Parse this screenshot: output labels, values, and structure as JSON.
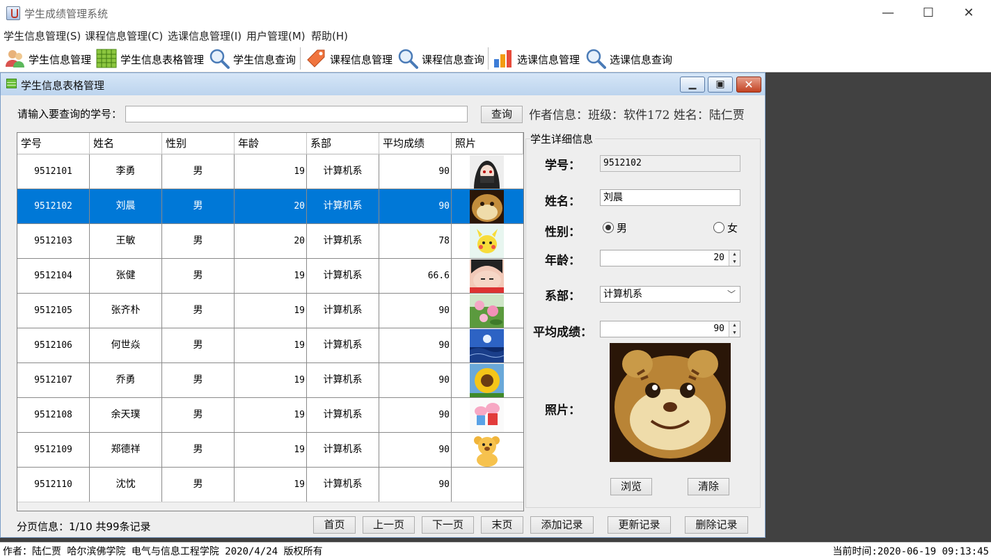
{
  "window": {
    "title": "学生成绩管理系统",
    "minimize_glyph": "—",
    "maximize_glyph": "☐",
    "close_glyph": "✕"
  },
  "menu": [
    "学生信息管理(S)",
    "课程信息管理(C)",
    "选课信息管理(I)",
    "用户管理(M)",
    "帮助(H)"
  ],
  "toolbar": [
    {
      "label": "学生信息管理",
      "icon": "users-icon"
    },
    {
      "label": "学生信息表格管理",
      "icon": "table-grid-icon"
    },
    {
      "label": "学生信息查询",
      "icon": "magnifier-icon"
    },
    {
      "label": "课程信息管理",
      "icon": "tag-icon"
    },
    {
      "label": "课程信息查询",
      "icon": "magnifier-icon"
    },
    {
      "label": "选课信息管理",
      "icon": "bar-chart-icon"
    },
    {
      "label": "选课信息查询",
      "icon": "magnifier-icon"
    }
  ],
  "internal_frame": {
    "title": "学生信息表格管理",
    "minimize_glyph": "▁",
    "maximize_glyph": "▣",
    "close_glyph": "✕"
  },
  "query": {
    "label": "请输入要查询的学号：",
    "value": "",
    "button": "查询",
    "author_info": "作者信息：班级：软件172 姓名：陆仁贾"
  },
  "table": {
    "columns": [
      "学号",
      "姓名",
      "性别",
      "年龄",
      "系部",
      "平均成绩",
      "照片"
    ],
    "rows": [
      {
        "id": "9512101",
        "name": "李勇",
        "gender": "男",
        "age": "19",
        "dept": "计算机系",
        "score": "90",
        "photo": "anime-boy-photo"
      },
      {
        "id": "9512102",
        "name": "刘晨",
        "gender": "男",
        "age": "20",
        "dept": "计算机系",
        "score": "90",
        "photo": "tiger-cub-photo",
        "selected": true
      },
      {
        "id": "9512103",
        "name": "王敏",
        "gender": "男",
        "age": "20",
        "dept": "计算机系",
        "score": "78",
        "photo": "pikachu-photo"
      },
      {
        "id": "9512104",
        "name": "张健",
        "gender": "男",
        "age": "19",
        "dept": "计算机系",
        "score": "66.6",
        "photo": "cartoon-boy-photo"
      },
      {
        "id": "9512105",
        "name": "张齐朴",
        "gender": "男",
        "age": "19",
        "dept": "计算机系",
        "score": "90",
        "photo": "lotus-photo"
      },
      {
        "id": "9512106",
        "name": "何世焱",
        "gender": "男",
        "age": "19",
        "dept": "计算机系",
        "score": "90",
        "photo": "sea-sun-photo"
      },
      {
        "id": "9512107",
        "name": "乔勇",
        "gender": "男",
        "age": "19",
        "dept": "计算机系",
        "score": "90",
        "photo": "sunflower-photo"
      },
      {
        "id": "9512108",
        "name": "余天璞",
        "gender": "男",
        "age": "19",
        "dept": "计算机系",
        "score": "90",
        "photo": "peppa-pig-photo"
      },
      {
        "id": "9512109",
        "name": "郑德祥",
        "gender": "男",
        "age": "19",
        "dept": "计算机系",
        "score": "90",
        "photo": "teddy-bear-photo"
      },
      {
        "id": "9512110",
        "name": "沈忱",
        "gender": "男",
        "age": "19",
        "dept": "计算机系",
        "score": "90",
        "photo": ""
      }
    ]
  },
  "detail": {
    "group_title": "学生详细信息",
    "id_label": "学号：",
    "id_value": "9512102",
    "name_label": "姓名：",
    "name_value": "刘晨",
    "gender_label": "性别：",
    "gender_male": "男",
    "gender_female": "女",
    "gender_selected": "男",
    "age_label": "年龄：",
    "age_value": "20",
    "dept_label": "系部：",
    "dept_value": "计算机系",
    "score_label": "平均成绩：",
    "score_value": "90",
    "photo_label": "照片：",
    "browse_button": "浏览",
    "clear_button": "清除"
  },
  "pagination": {
    "info": "分页信息：1/10 共99条记录",
    "first": "首页",
    "prev": "上一页",
    "next": "下一页",
    "last": "末页",
    "add": "添加记录",
    "update": "更新记录",
    "delete": "删除记录"
  },
  "status": {
    "left": "作者：陆仁贾 哈尔滨佛学院 电气与信息工程学院 2020/4/24 版权所有",
    "right": "当前时间:2020-06-19 09:13:45"
  },
  "colors": {
    "selection": "#0078d7",
    "desktop": "#414141",
    "frame_title": "#c7dbf1"
  }
}
